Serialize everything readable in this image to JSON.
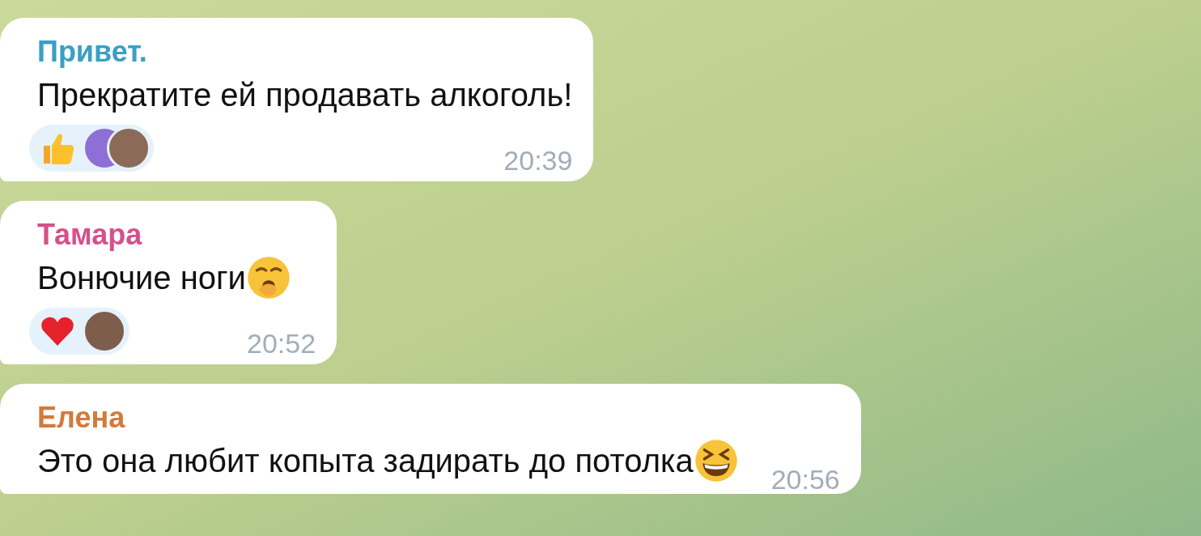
{
  "messages": [
    {
      "sender": "Привет.",
      "color": "#3a9fc4",
      "text": "Прекратите ей продавать алкоголь!",
      "reactions": [
        {
          "kind": "thumbs_up"
        }
      ],
      "avatars": [
        {
          "color": "#8e6fd6"
        },
        {
          "color": "#8b6b57"
        }
      ],
      "time": "20:39"
    },
    {
      "sender": "Тамара",
      "color": "#d6508a",
      "text": "Вонючие ноги",
      "inline_icon": {
        "kind": "yawn"
      },
      "reactions": [
        {
          "kind": "heart"
        }
      ],
      "avatars": [
        {
          "color": "#7d5e4c"
        }
      ],
      "time": "20:52"
    },
    {
      "sender": "Елена",
      "color": "#d47a3a",
      "text": "Это она любит копыта задирать до потолка",
      "inline_icon": {
        "kind": "laugh"
      },
      "time": "20:56"
    }
  ]
}
